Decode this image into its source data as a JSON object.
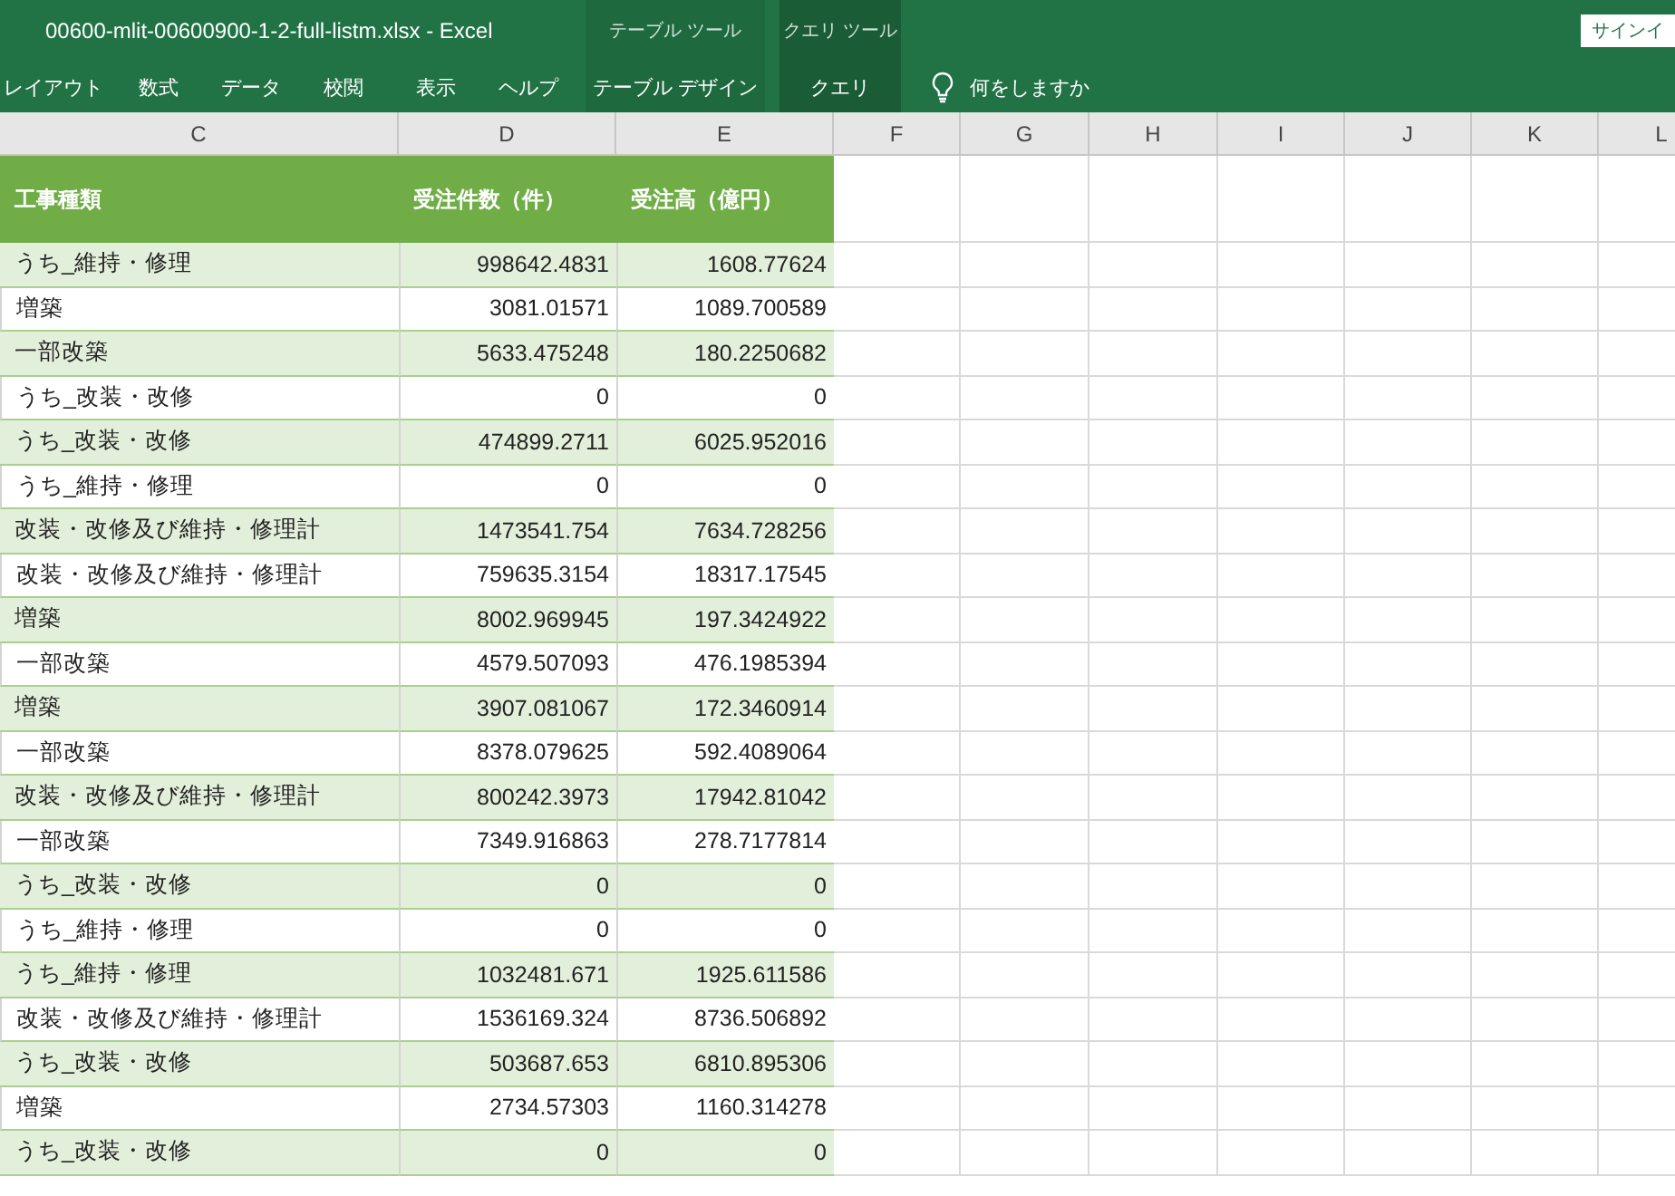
{
  "window": {
    "title": "00600-mlit-00600900-1-2-full-listm.xlsx  -  Excel",
    "sign_in": "サインイ"
  },
  "ribbon_tabs": [
    "レイアウト",
    "数式",
    "データ",
    "校閲",
    "表示",
    "ヘルプ"
  ],
  "context_groups": [
    {
      "label": "テーブル ツール",
      "tab": "テーブル デザイン"
    },
    {
      "label": "クエリ ツール",
      "tab": "クエリ"
    }
  ],
  "search": {
    "placeholder": "何をしますか"
  },
  "sheet": {
    "column_letters": [
      "C",
      "D",
      "E",
      "F",
      "G",
      "H",
      "I",
      "J",
      "K",
      "L"
    ],
    "table_headers": [
      "工事種類",
      "受注件数（件）",
      "受注高（億円）"
    ],
    "rows": [
      [
        "うち_維持・修理",
        "998642.4831",
        "1608.77624"
      ],
      [
        "増築",
        "3081.01571",
        "1089.700589"
      ],
      [
        "一部改築",
        "5633.475248",
        "180.2250682"
      ],
      [
        "うち_改装・改修",
        "0",
        "0"
      ],
      [
        "うち_改装・改修",
        "474899.2711",
        "6025.952016"
      ],
      [
        "うち_維持・修理",
        "0",
        "0"
      ],
      [
        "改装・改修及び維持・修理計",
        "1473541.754",
        "7634.728256"
      ],
      [
        "改装・改修及び維持・修理計",
        "759635.3154",
        "18317.17545"
      ],
      [
        "増築",
        "8002.969945",
        "197.3424922"
      ],
      [
        "一部改築",
        "4579.507093",
        "476.1985394"
      ],
      [
        "増築",
        "3907.081067",
        "172.3460914"
      ],
      [
        "一部改築",
        "8378.079625",
        "592.4089064"
      ],
      [
        "改装・改修及び維持・修理計",
        "800242.3973",
        "17942.81042"
      ],
      [
        "一部改築",
        "7349.916863",
        "278.7177814"
      ],
      [
        "うち_改装・改修",
        "0",
        "0"
      ],
      [
        "うち_維持・修理",
        "0",
        "0"
      ],
      [
        "うち_維持・修理",
        "1032481.671",
        "1925.611586"
      ],
      [
        "改装・改修及び維持・修理計",
        "1536169.324",
        "8736.506892"
      ],
      [
        "うち_改装・改修",
        "503687.653",
        "6810.895306"
      ],
      [
        "増築",
        "2734.57303",
        "1160.314278"
      ],
      [
        "うち_改装・改修",
        "0",
        "0"
      ]
    ]
  }
}
